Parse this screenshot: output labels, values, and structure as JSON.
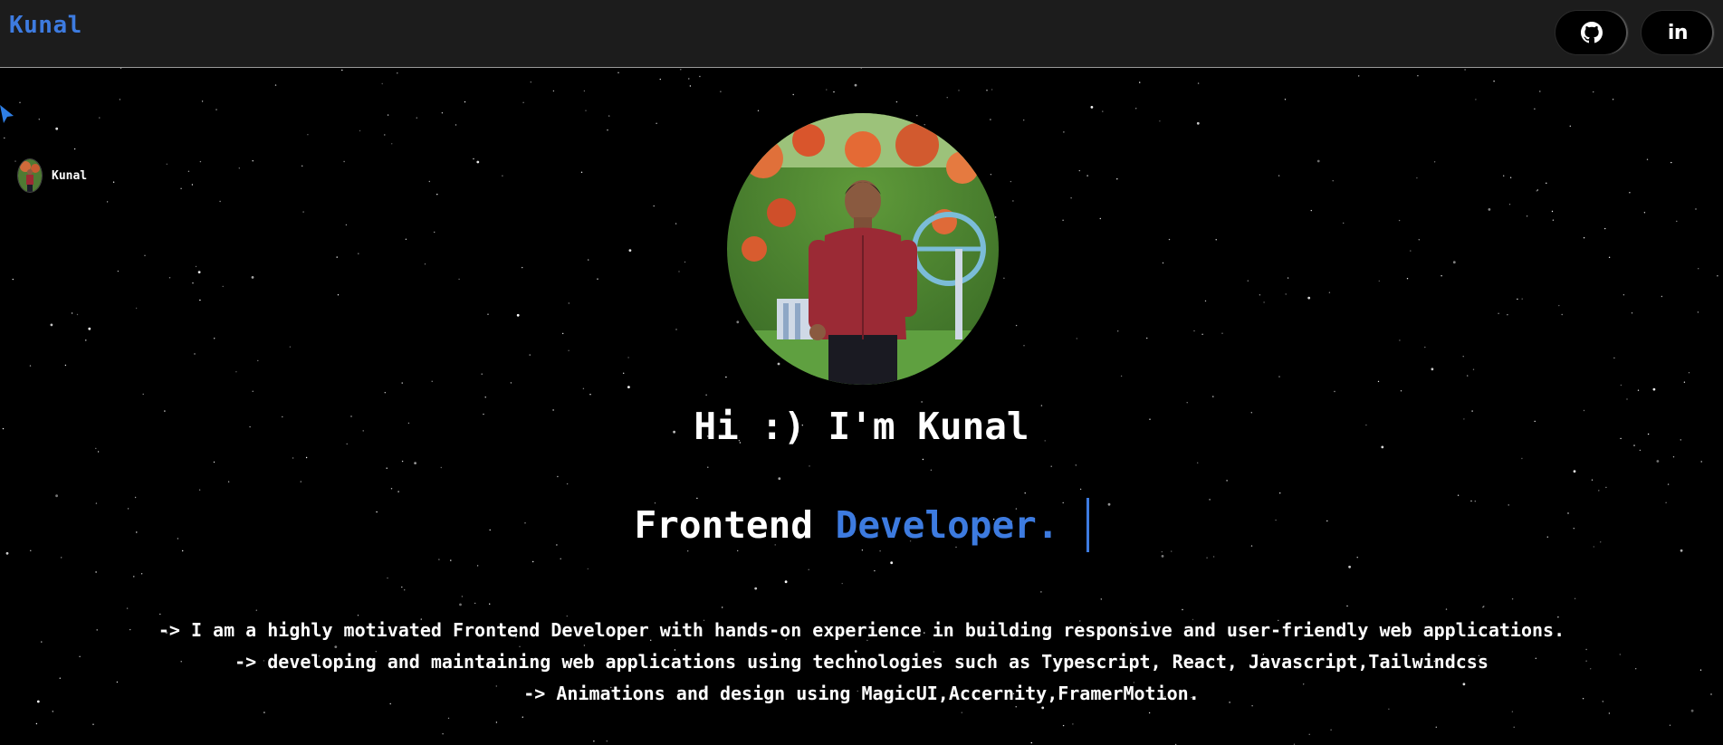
{
  "navbar": {
    "brand": "Kunal",
    "github_icon": "github-icon",
    "linkedin_text": "in",
    "linkedin_icon": "linkedin-icon"
  },
  "sidebar_user": {
    "name": "Kunal"
  },
  "hero": {
    "greeting": "Hi :) I'm Kunal",
    "role_prefix": "Frontend",
    "role_highlight": "Developer."
  },
  "description": [
    "-> I am a highly motivated Frontend Developer with hands-on experience in building responsive and user-friendly web applications.",
    "-> developing and maintaining web applications using technologies such as Typescript, React, Javascript,Tailwindcss",
    "-> Animations and design using MagicUI,Accernity,FramerMotion."
  ],
  "colors": {
    "accent": "#3d7be0",
    "background": "#000000",
    "navbar": "#1c1c1c",
    "text": "#ffffff"
  }
}
